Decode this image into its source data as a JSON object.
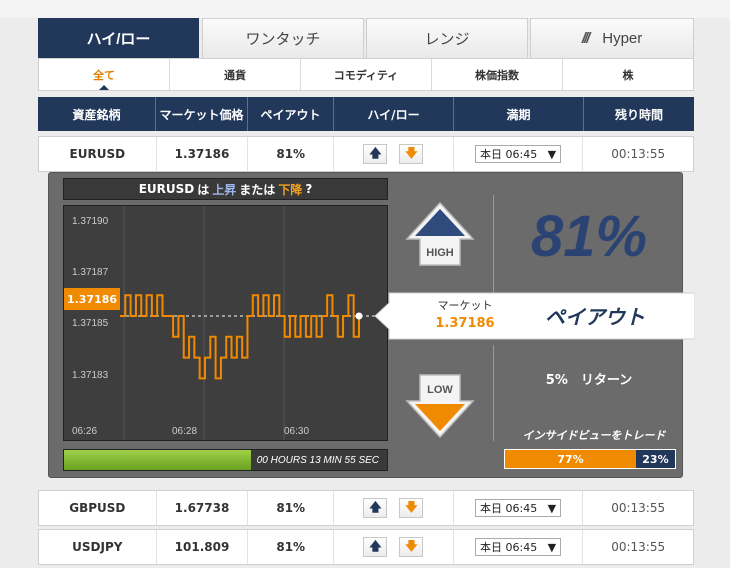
{
  "tabs": [
    {
      "label": "ハイ/ロー",
      "active": true
    },
    {
      "label": "ワンタッチ",
      "active": false
    },
    {
      "label": "レンジ",
      "active": false
    },
    {
      "label": "Hyper",
      "active": false,
      "icon": "triple-slash-icon"
    }
  ],
  "categories": [
    {
      "label": "全て",
      "active": true
    },
    {
      "label": "通貨"
    },
    {
      "label": "コモディティ"
    },
    {
      "label": "株価指数"
    },
    {
      "label": "株"
    }
  ],
  "table": {
    "headers": [
      "資産銘柄",
      "マーケット価格",
      "ペイアウト",
      "ハイ/ロー",
      "満期",
      "残り時間"
    ],
    "rows": [
      {
        "asset": "EURUSD",
        "price": "1.37186",
        "payout": "81%",
        "expiry": "本日 06:45",
        "remaining": "00:13:55"
      },
      {
        "asset": "GBPUSD",
        "price": "1.67738",
        "payout": "81%",
        "expiry": "本日 06:45",
        "remaining": "00:13:55"
      },
      {
        "asset": "USDJPY",
        "price": "101.809",
        "payout": "81%",
        "expiry": "本日 06:45",
        "remaining": "00:13:55"
      }
    ]
  },
  "panel": {
    "title_asset": "EURUSD",
    "title_ha": "は",
    "title_up": "上昇",
    "title_or": "または",
    "title_down": "下降",
    "title_q": "?",
    "high_label": "HIGH",
    "low_label": "LOW",
    "market_label": "マーケット",
    "market_value": "1.37186",
    "payout_label": "ペイアウト",
    "payout_pct": "81%",
    "return_text": "5%　リターン",
    "inside_view": "インサイドビューをトレード",
    "ratio_high": "77%",
    "ratio_low": "23%",
    "ratio_high_fraction": 0.77,
    "countdown": "00 HOURS 13 MIN 55 SEC",
    "countdown_fraction": 0.58,
    "accent_orange": "#f08a00",
    "navy": "#22385a"
  },
  "chart_data": {
    "type": "line",
    "y_ticks": [
      "1.37190",
      "1.37187",
      "1.37185",
      "1.37183"
    ],
    "x_ticks": [
      "06:26",
      "06:28",
      "06:30"
    ],
    "current_label": "1.37186",
    "ylim": [
      1.37181,
      1.37191
    ],
    "xlim": [
      0,
      100
    ],
    "values": [
      1.37186,
      1.37187,
      1.37186,
      1.37187,
      1.37186,
      1.37187,
      1.37186,
      1.37187,
      1.37186,
      1.37186,
      1.37185,
      1.37186,
      1.37184,
      1.37185,
      1.37184,
      1.37183,
      1.37184,
      1.37185,
      1.37183,
      1.37184,
      1.37185,
      1.37184,
      1.37185,
      1.37184,
      1.37186,
      1.37187,
      1.37186,
      1.37187,
      1.37186,
      1.37187,
      1.37186,
      1.37185,
      1.37186,
      1.37185,
      1.37186,
      1.37185,
      1.37186,
      1.37185,
      1.37186,
      1.37187,
      1.37186,
      1.37185,
      1.37186,
      1.37187,
      1.37185,
      1.37186
    ]
  }
}
